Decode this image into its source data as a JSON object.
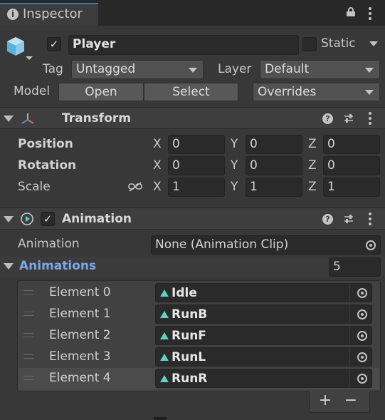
{
  "tab": {
    "title": "Inspector",
    "icon": "info-icon"
  },
  "gameobject": {
    "active": true,
    "name": "Player",
    "static_label": "Static",
    "static_checked": false
  },
  "tag": {
    "label": "Tag",
    "value": "Untagged"
  },
  "layer": {
    "label": "Layer",
    "value": "Default"
  },
  "model": {
    "label": "Model",
    "open_label": "Open",
    "select_label": "Select",
    "overrides_label": "Overrides"
  },
  "transform": {
    "title": "Transform",
    "position": {
      "label": "Position",
      "x": "0",
      "y": "0",
      "z": "0"
    },
    "rotation": {
      "label": "Rotation",
      "x": "0",
      "y": "0",
      "z": "0"
    },
    "scale": {
      "label": "Scale",
      "x": "1",
      "y": "1",
      "z": "1"
    },
    "axis_x": "X",
    "axis_y": "Y",
    "axis_z": "Z"
  },
  "animation": {
    "title": "Animation",
    "enabled": true,
    "clip_label": "Animation",
    "clip_value": "None (Animation Clip)",
    "animations_label": "Animations",
    "animations_count": "5",
    "elements": [
      {
        "label": "Element 0",
        "value": "Idle"
      },
      {
        "label": "Element 1",
        "value": "RunB"
      },
      {
        "label": "Element 2",
        "value": "RunF"
      },
      {
        "label": "Element 3",
        "value": "RunL"
      },
      {
        "label": "Element 4",
        "value": "RunR"
      }
    ],
    "add_label": "+",
    "remove_label": "−"
  },
  "colors": {
    "accent_blue": "#7aa7e8",
    "clip_icon": "#5fd1c5",
    "tab_highlight": "#3a79bb"
  }
}
